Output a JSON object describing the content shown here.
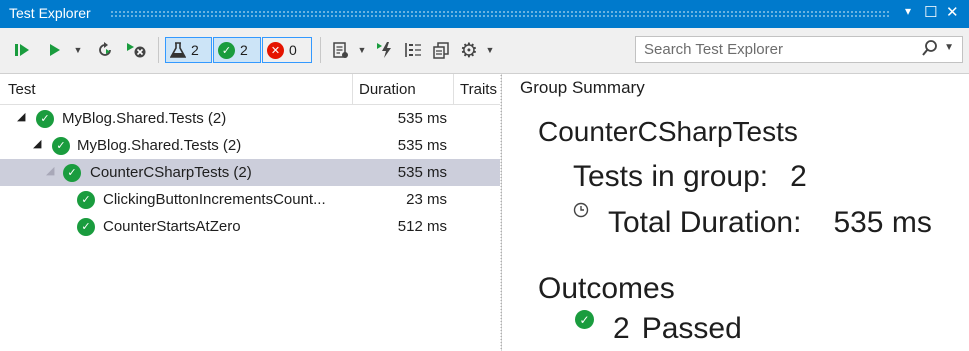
{
  "window": {
    "title": "Test Explorer",
    "controls": [
      "▾",
      "☐",
      "✕"
    ]
  },
  "toolbar": {
    "filter_total": "2",
    "filter_passed": "2",
    "filter_failed": "0",
    "search_placeholder": "Search Test Explorer",
    "search_value": ""
  },
  "columns": {
    "test": "Test",
    "duration": "Duration",
    "traits": "Traits"
  },
  "tree": [
    {
      "name": "MyBlog.Shared.Tests (2)",
      "duration": "535 ms",
      "status": "passed",
      "expanded": true
    },
    {
      "name": "MyBlog.Shared.Tests (2)",
      "duration": "535 ms",
      "status": "passed",
      "expanded": true
    },
    {
      "name": "CounterCSharpTests (2)",
      "duration": "535 ms",
      "status": "passed",
      "expanded": true,
      "selected": true
    },
    {
      "name": "ClickingButtonIncrementsCount...",
      "duration": "23 ms",
      "status": "passed"
    },
    {
      "name": "CounterStartsAtZero",
      "duration": "512 ms",
      "status": "passed"
    }
  ],
  "summary": {
    "header": "Group Summary",
    "group_name": "CounterCSharpTests",
    "tests_in_group_label": "Tests in group:",
    "tests_in_group_value": "2",
    "total_duration_label": "Total Duration:",
    "total_duration_value": "535 ms",
    "outcomes_label": "Outcomes",
    "passed_count": "2",
    "passed_label": "Passed"
  },
  "colors": {
    "accent": "#007acc",
    "passed": "#1a9c3e",
    "failed": "#e51400",
    "selection": "#cccedb"
  },
  "icons": [
    "run-all-icon",
    "run-icon",
    "repeat-run-icon",
    "cancel-icon",
    "flask-icon",
    "check-icon",
    "error-icon",
    "playlist-icon",
    "run-tests-after-build-icon",
    "group-by-icon",
    "copy-icon",
    "settings-icon",
    "search-icon",
    "clock-icon"
  ]
}
